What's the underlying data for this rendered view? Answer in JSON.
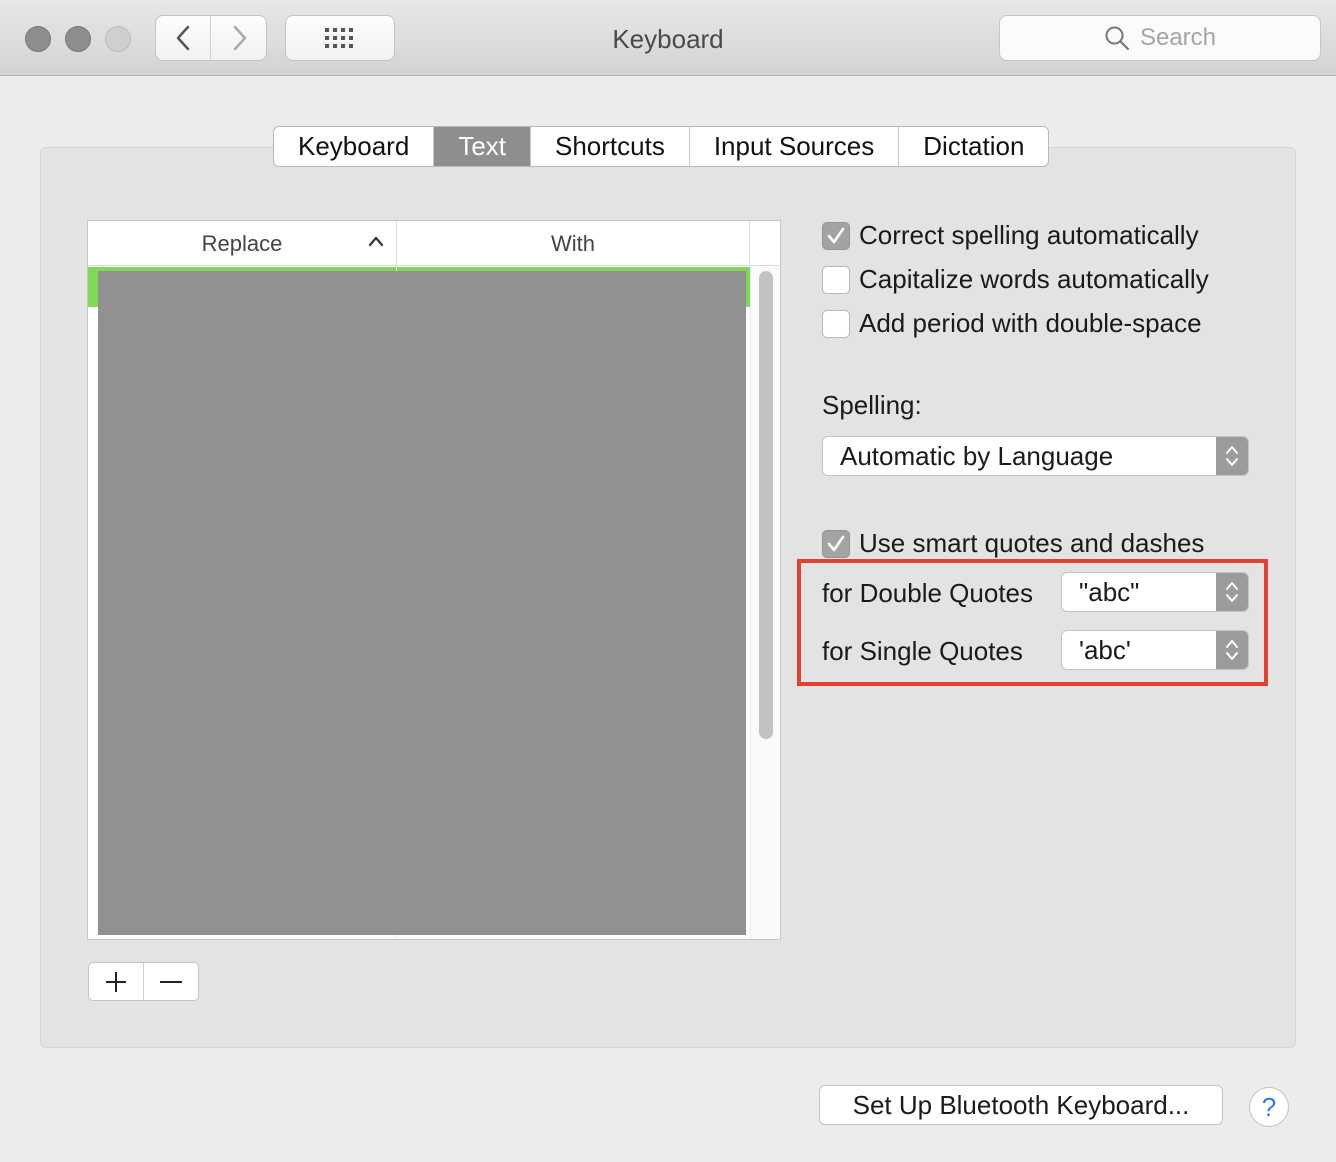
{
  "window": {
    "title": "Keyboard",
    "search_placeholder": "Search"
  },
  "tabs": [
    {
      "label": "Keyboard",
      "active": false
    },
    {
      "label": "Text",
      "active": true
    },
    {
      "label": "Shortcuts",
      "active": false
    },
    {
      "label": "Input Sources",
      "active": false
    },
    {
      "label": "Dictation",
      "active": false
    }
  ],
  "table": {
    "columns": [
      "Replace",
      "With"
    ],
    "sort": "ascending"
  },
  "options": {
    "correct_spelling": {
      "label": "Correct spelling automatically",
      "checked": true
    },
    "capitalize_words": {
      "label": "Capitalize words automatically",
      "checked": false
    },
    "add_period": {
      "label": "Add period with double-space",
      "checked": false
    }
  },
  "spelling": {
    "label": "Spelling:",
    "value": "Automatic by Language"
  },
  "smart_quotes": {
    "label": "Use smart quotes and dashes",
    "checked": true,
    "double_label": "for Double Quotes",
    "double_value": "\"abc\"",
    "single_label": "for Single Quotes",
    "single_value": "'abc'"
  },
  "footer": {
    "bluetooth_button": "Set Up Bluetooth Keyboard...",
    "help_glyph": "?"
  },
  "colors": {
    "accent_green": "#7ed957",
    "highlight_red": "#e2412e",
    "help_blue": "#2a7df0"
  }
}
